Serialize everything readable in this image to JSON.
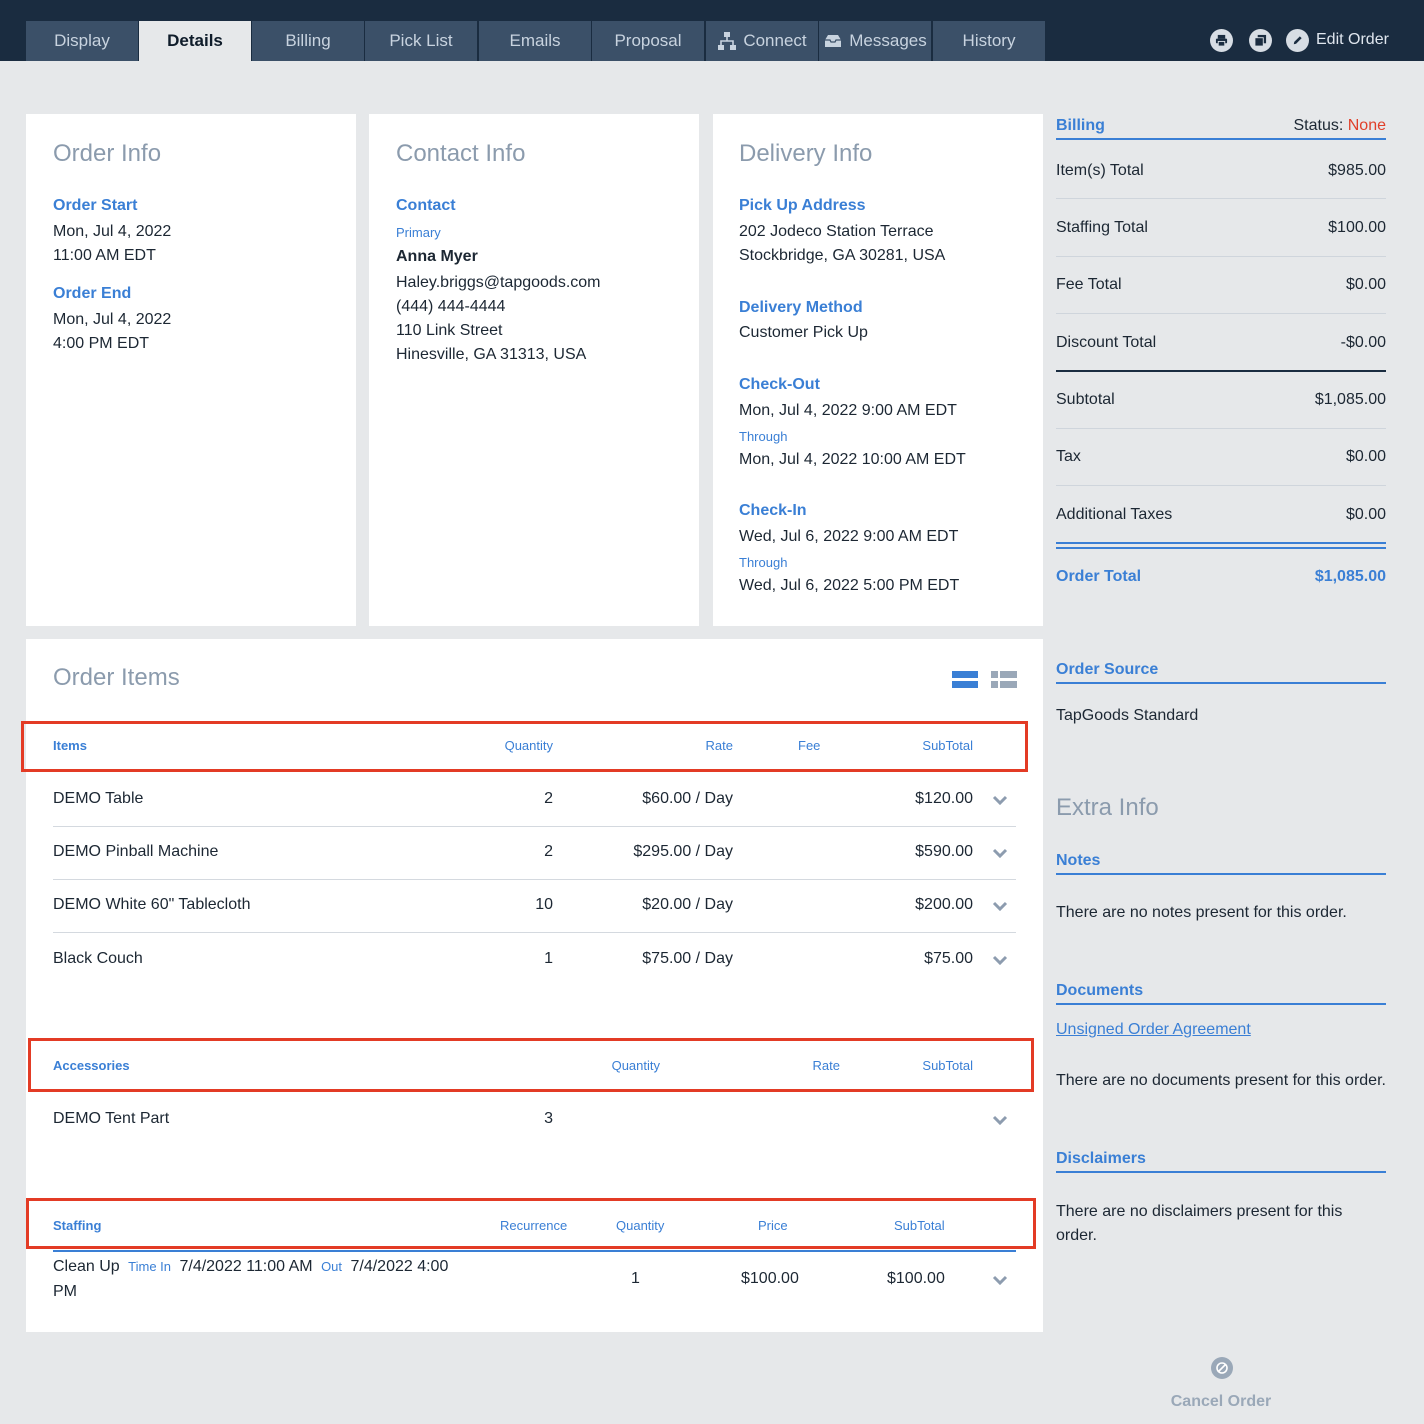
{
  "tabs": [
    {
      "label": "Display"
    },
    {
      "label": "Details"
    },
    {
      "label": "Billing"
    },
    {
      "label": "Pick List"
    },
    {
      "label": "Emails"
    },
    {
      "label": "Proposal"
    },
    {
      "label": "Connect"
    },
    {
      "label": "Messages"
    },
    {
      "label": "History"
    }
  ],
  "toolbar": {
    "edit_order": "Edit Order"
  },
  "order_info": {
    "title": "Order Info",
    "start_label": "Order Start",
    "start_date": "Mon, Jul 4, 2022",
    "start_time": "11:00 AM EDT",
    "end_label": "Order End",
    "end_date": "Mon, Jul 4, 2022",
    "end_time": "4:00 PM EDT"
  },
  "contact_info": {
    "title": "Contact Info",
    "contact_label": "Contact",
    "role": "Primary",
    "name": "Anna Myer",
    "email": "Haley.briggs@tapgoods.com",
    "phone": "(444) 444-4444",
    "street": "110 Link Street",
    "city": "Hinesville, GA 31313, USA"
  },
  "delivery_info": {
    "title": "Delivery Info",
    "pickup_label": "Pick Up Address",
    "pickup_street": "202 Jodeco Station Terrace",
    "pickup_city": "Stockbridge, GA 30281, USA",
    "method_label": "Delivery Method",
    "method": "Customer Pick Up",
    "checkout_label": "Check-Out",
    "checkout_start": "Mon, Jul 4, 2022 9:00 AM EDT",
    "through1": "Through",
    "checkout_end": "Mon, Jul 4, 2022 10:00 AM EDT",
    "checkin_label": "Check-In",
    "checkin_start": "Wed, Jul 6, 2022 9:00 AM EDT",
    "through2": "Through",
    "checkin_end": "Wed, Jul 6, 2022 5:00 PM EDT"
  },
  "order_items": {
    "title": "Order Items",
    "items_header": {
      "items": "Items",
      "quantity": "Quantity",
      "rate": "Rate",
      "fee": "Fee",
      "subtotal": "SubTotal"
    },
    "items": [
      {
        "name": "DEMO Table",
        "qty": "2",
        "rate": "$60.00 / Day",
        "subtotal": "$120.00"
      },
      {
        "name": "DEMO Pinball Machine",
        "qty": "2",
        "rate": "$295.00 / Day",
        "subtotal": "$590.00"
      },
      {
        "name": "DEMO White 60\" Tablecloth",
        "qty": "10",
        "rate": "$20.00 / Day",
        "subtotal": "$200.00"
      },
      {
        "name": "Black Couch",
        "qty": "1",
        "rate": "$75.00 / Day",
        "subtotal": "$75.00"
      }
    ],
    "accessories_header": {
      "accessories": "Accessories",
      "quantity": "Quantity",
      "rate": "Rate",
      "subtotal": "SubTotal"
    },
    "accessories": [
      {
        "name": "DEMO Tent Part",
        "qty": "3"
      }
    ],
    "staffing_header": {
      "staffing": "Staffing",
      "recurrence": "Recurrence",
      "quantity": "Quantity",
      "price": "Price",
      "subtotal": "SubTotal"
    },
    "staffing": [
      {
        "name": "Clean Up",
        "time_in_label": "Time In",
        "time_in": "7/4/2022 11:00 AM",
        "out_label": "Out",
        "time_out_a": "7/4/2022 4:00",
        "time_out_b": "PM",
        "qty": "1",
        "price": "$100.00",
        "subtotal": "$100.00"
      }
    ]
  },
  "billing": {
    "title": "Billing",
    "status_label": "Status:",
    "status_value": "None",
    "rows": [
      {
        "label": "Item(s) Total",
        "value": "$985.00"
      },
      {
        "label": "Staffing Total",
        "value": "$100.00"
      },
      {
        "label": "Fee Total",
        "value": "$0.00"
      },
      {
        "label": "Discount Total",
        "value": "-$0.00"
      },
      {
        "label": "Subtotal",
        "value": "$1,085.00"
      },
      {
        "label": "Tax",
        "value": "$0.00"
      },
      {
        "label": "Additional Taxes",
        "value": "$0.00"
      }
    ],
    "total_label": "Order Total",
    "total_value": "$1,085.00"
  },
  "order_source": {
    "title": "Order Source",
    "value": "TapGoods Standard"
  },
  "extra_info": {
    "title": "Extra Info",
    "notes_label": "Notes",
    "notes_text": "There are no notes present for this order.",
    "documents_label": "Documents",
    "documents_link": "Unsigned Order Agreement",
    "documents_text": "There are no documents present for this order.",
    "disclaimers_label": "Disclaimers",
    "disclaimers_text_a": "There are no disclaimers present for this",
    "disclaimers_text_b": "order."
  },
  "cancel_order": "Cancel Order",
  "colors": {
    "accent": "#3a7fd5",
    "status_none": "#e0402a",
    "highlight": "#e33b25",
    "nav": "#1a2c40"
  }
}
